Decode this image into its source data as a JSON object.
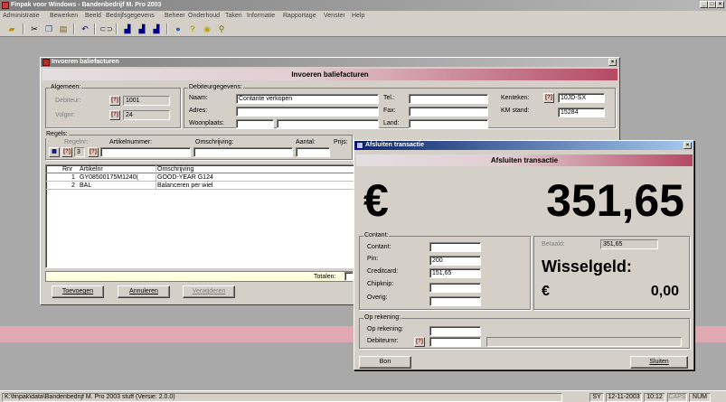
{
  "app": {
    "title": "Finpak voor Windows - Bandenbedrijf M. Pro 2003",
    "menu": [
      "Administratie",
      "Bewerken",
      "Beeld",
      "Bedrijfsgegevens",
      "Beheer",
      "Onderhoud",
      "Taken",
      "Informatie",
      "Rapportage",
      "Venster",
      "Help"
    ],
    "toolbar_icons": [
      "open-icon",
      "cut-icon",
      "copy-icon",
      "paste-icon",
      "undo-icon",
      "link-icon",
      "chart-icon",
      "chart2-icon",
      "chart3-icon",
      "globe-icon",
      "help-icon",
      "info-icon",
      "tool-icon"
    ],
    "title_buttons": [
      "_",
      "□",
      "×"
    ],
    "status": {
      "path": "K:\\finpak\\data\\Bandenbedrijf M. Pro 2003 stuff (Versie: 2.0.0)",
      "user": "SY",
      "date": "12-11-2003",
      "time": "10:12",
      "caps": "CAPS",
      "num": "NUM"
    },
    "accent_color": "#e0a8b0"
  },
  "invoice": {
    "window_title": "Invoeren baliefacturen",
    "header": "Invoeren baliefacturen",
    "close": "×",
    "general": {
      "group": "Algemeen:",
      "debiteur_label": "Debiteur:",
      "debiteur_value": "1001",
      "volgnr_label": "Volgnr:",
      "volgnr_value": "24"
    },
    "debtor": {
      "group": "Debiteurgegevens:",
      "naam_label": "Naam:",
      "naam_value": "Contante verkopen",
      "adres_label": "Adres:",
      "adres_value": "",
      "woonplaats_label": "Woonplaats:",
      "tel_label": "Tel.:",
      "fax_label": "Fax:",
      "land_label": "Land:",
      "kenteken_label": "Kenteken:",
      "kenteken_value": "10JD-SX",
      "km_label": "KM stand:",
      "km_value": "15284"
    },
    "lines": {
      "group": "Regels:",
      "regelnr_label": "Regelnr:",
      "regelnr_value": "3",
      "artikel_label": "Artikelnummer:",
      "omschrijving_label": "Omschrijving:",
      "aantal_label": "Aantal:",
      "prijs_label": "Prijs:"
    },
    "grid": {
      "columns": [
        "Rnr",
        "Artikelnr",
        "Omschrijving"
      ],
      "rows": [
        {
          "rnr": "1",
          "artikelnr": "GY08500175M1240(",
          "omschrijving": "GOOD-YEAR G124"
        },
        {
          "rnr": "2",
          "artikelnr": "BAL",
          "omschrijving": "Balanceren per wiel"
        }
      ]
    },
    "totalen_label": "Totalen:",
    "buttons": {
      "toevoegen": "Toevoegen",
      "annuleren": "Annuleren",
      "verwijderen": "Verwijderen"
    }
  },
  "dialog": {
    "window_title": "Afsluiten transactie",
    "header": "Afsluiten transactie",
    "close": "×",
    "currency": "€",
    "total": "351,65",
    "contant": {
      "group": "Contant:",
      "contant_label": "Contant:",
      "contant_value": "",
      "pin_label": "Pin:",
      "pin_value": "200",
      "creditcard_label": "Creditcard:",
      "creditcard_value": "151,65",
      "chipknip_label": "Chipknip:",
      "chipknip_value": "",
      "overig_label": "Overig:",
      "overig_value": ""
    },
    "betaald_label": "Betaald:",
    "betaald_value": "351,65",
    "wisselgeld_label": "Wisselgeld:",
    "wisselgeld_currency": "€",
    "wisselgeld_value": "0,00",
    "op_rekening": {
      "group": "Op rekening:",
      "rekening_label": "Op rekening:",
      "debiteurnr_label": "Debiteurnr:"
    },
    "buttons": {
      "bon": "Bon",
      "sluiten": "Sluiten"
    }
  }
}
